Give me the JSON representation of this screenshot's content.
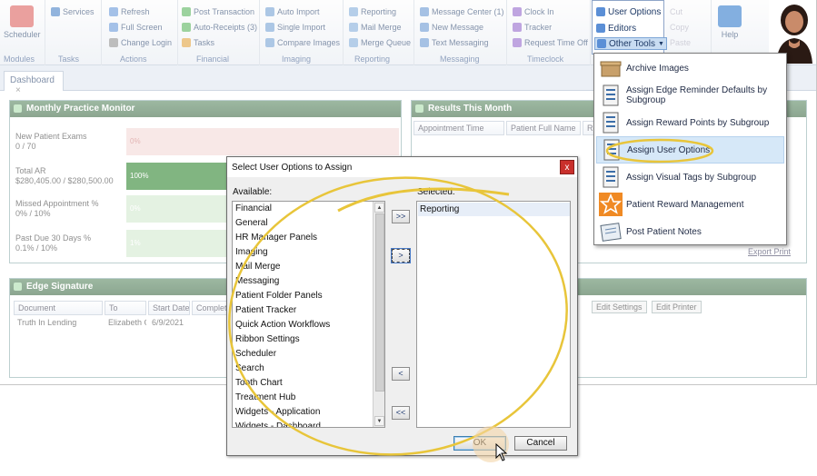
{
  "ribbon": {
    "groups": [
      {
        "label": "Modules",
        "buttons": [
          "Scheduler"
        ]
      },
      {
        "label": "Tasks",
        "buttons": [
          "Services"
        ]
      },
      {
        "label": "Actions",
        "buttons": [
          "Refresh",
          "Full Screen",
          "Change Login"
        ]
      },
      {
        "label": "Financial",
        "buttons": [
          "Post Transaction",
          "Auto-Receipts (3)",
          "Tasks"
        ]
      },
      {
        "label": "Imaging",
        "buttons": [
          "Auto Import",
          "Single Import",
          "Compare Images"
        ]
      },
      {
        "label": "Reporting",
        "buttons": [
          "Reporting",
          "Mail Merge",
          "Merge Queue"
        ]
      },
      {
        "label": "Messaging",
        "buttons": [
          "Message Center (1)",
          "New Message",
          "Text Messaging"
        ]
      },
      {
        "label": "Timeclock",
        "buttons": [
          "Clock In",
          "Tracker",
          "Request Time Off"
        ]
      }
    ],
    "tools": {
      "user_options": "User Options",
      "editors": "Editors",
      "other_tools": "Other Tools"
    },
    "faded_buttons": [
      "Cut",
      "Copy",
      "Paste"
    ],
    "help": "Help"
  },
  "tabs": {
    "dashboard": "Dashboard"
  },
  "monthly_monitor": {
    "title": "Monthly Practice Monitor",
    "metrics": [
      {
        "label": "New Patient Exams",
        "value": "0 / 70",
        "bar": "0%",
        "fill": 0.0
      },
      {
        "label": "Total AR",
        "value": "$280,405.00 / $280,500.00",
        "bar": "100%",
        "fill": 1.0
      },
      {
        "label": "Missed Appointment %",
        "value": "0% / 10%",
        "bar": "0%",
        "fill": 0.0
      },
      {
        "label": "Past Due 30 Days %",
        "value": "0.1% / 10%",
        "bar": "1%",
        "fill": 0.01
      }
    ]
  },
  "results_panel": {
    "title": "Results This Month",
    "columns": [
      "Appointment Time",
      "Patient Full Name",
      "Re"
    ],
    "export": "Export Print"
  },
  "edge_signature": {
    "title": "Edge Signature",
    "columns": [
      "Document",
      "To",
      "Start Date",
      "Complete"
    ],
    "rows": [
      [
        "Truth In Lending",
        "Elizabeth C",
        "6/9/2021",
        ""
      ]
    ],
    "buttons": [
      "Edit Settings",
      "Edit Printer"
    ]
  },
  "other_tools_menu": {
    "items": [
      "Archive Images",
      "Assign Edge Reminder Defaults by Subgroup",
      "Assign Reward Points by Subgroup",
      "Assign User Options",
      "Assign Visual Tags by Subgroup",
      "Patient Reward Management",
      "Post Patient Notes"
    ],
    "highlighted_index": 3
  },
  "dialog": {
    "title": "Select User Options to Assign",
    "close": "x",
    "available_label": "Available:",
    "selected_label": "Selected:",
    "available": [
      "Financial",
      "General",
      "HR Manager Panels",
      "Imaging",
      "Mail Merge",
      "Messaging",
      "Patient Folder Panels",
      "Patient Tracker",
      "Quick Action Workflows",
      "Ribbon Settings",
      "Scheduler",
      "Search",
      "Tooth Chart",
      "Treatment Hub",
      "Widgets - Application",
      "Widgets - Dashboard"
    ],
    "selected": [
      "Reporting"
    ],
    "move_all_right": ">>",
    "move_right": ">",
    "move_left": "<",
    "move_all_left": "<<",
    "ok": "OK",
    "cancel": "Cancel"
  },
  "colors": {
    "panel_header": "#2e5e36",
    "highlight_yellow": "#e8c53a",
    "selection_blue": "#d6e8f8",
    "close_red": "#c9302c"
  }
}
